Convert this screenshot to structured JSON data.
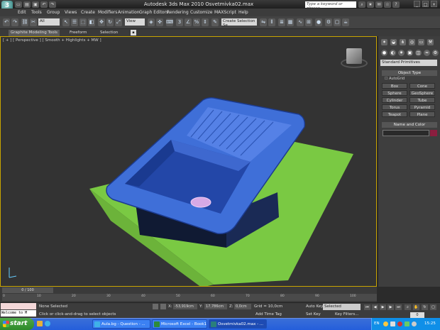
{
  "app": {
    "logo": "3",
    "title": "Autodesk 3ds Max  2010     Osvetmivka02.max"
  },
  "search": {
    "placeholder": "Type a keyword or phrase"
  },
  "menu": [
    "Edit",
    "Tools",
    "Group",
    "Views",
    "Create",
    "Modifiers",
    "Animation",
    "Graph Editors",
    "Rendering",
    "Customize",
    "MAXScript",
    "Help"
  ],
  "toolbar": {
    "selection_filter": "All",
    "ref_coord": "View",
    "selection_set": "Create Selection Se"
  },
  "ribbon": {
    "tabs": [
      "Graphite Modeling Tools",
      "Freeform",
      "Selection"
    ]
  },
  "viewport": {
    "label": "[ + ] [ Perspective ] [ Smooth + Highlights + MW ]"
  },
  "command_panel": {
    "category": "Standard Primitives",
    "object_type_title": "Object Type",
    "autogrid_label": "AutoGrid",
    "primitives": [
      "Box",
      "Cone",
      "Sphere",
      "GeoSphere",
      "Cylinder",
      "Tube",
      "Torus",
      "Pyramid",
      "Teapot",
      "Plane"
    ],
    "name_color_title": "Name and Color"
  },
  "timeline": {
    "slider_label": "0 / 100",
    "ticks": [
      "0",
      "10",
      "20",
      "30",
      "40",
      "50",
      "60",
      "70",
      "80",
      "90",
      "100"
    ]
  },
  "status": {
    "listener_text": "Welcome to M",
    "selection": "None Selected",
    "prompt": "Click or click-and-drag to select objects",
    "x_label": "X:",
    "x_value": "-53,919cm",
    "y_label": "Y:",
    "y_value": "17,786cm",
    "z_label": "Z:",
    "z_value": "0,0cm",
    "grid": "Grid = 10,0cm",
    "add_time_tag": "Add Time Tag",
    "auto_key": "Auto Key",
    "set_key": "Set Key",
    "selected_option": "Selected",
    "key_filters": "Key Filters...",
    "frame": "0"
  },
  "taskbar": {
    "start_label": "start",
    "tasks": [
      "Aula.bg - Question - ...",
      "Microsoft Excel - Book1",
      "Osvetmivka02.max - ..."
    ],
    "language": "EN",
    "clock": "15:25"
  },
  "colors": {
    "viewport_border": "#c8a400",
    "object_color": "#8b1e3f",
    "plane_green": "#7ac943",
    "sink_blue": "#3f6fd8"
  }
}
